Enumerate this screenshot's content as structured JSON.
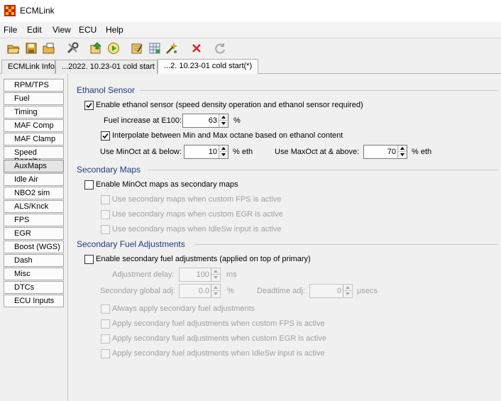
{
  "window": {
    "title": "ECMLink"
  },
  "menu": [
    "File",
    "Edit",
    "View",
    "ECU",
    "Help"
  ],
  "toolbar": [
    "open-folder-icon",
    "save-icon",
    "open-multiple-icon",
    "tools-icon",
    "upload-icon",
    "play-icon",
    "map-edit-icon",
    "grid-edit-icon",
    "wand-icon",
    "close-x-icon",
    "refresh-icon"
  ],
  "tabs": [
    "ECMLink Info",
    "...2022. 10.23-01  cold start",
    "...2. 10.23-01  cold start(*)"
  ],
  "sidebar": [
    "RPM/TPS",
    "Fuel",
    "Timing",
    "MAF Comp",
    "MAF Clamp",
    "Speed Density",
    "AuxMaps",
    "Idle Air",
    "NBO2 sim",
    "ALS/Knck",
    "FPS",
    "EGR",
    "Boost (WGS)",
    "Dash",
    "Misc",
    "DTCs",
    "ECU Inputs"
  ],
  "ethanol": {
    "title": "Ethanol Sensor",
    "enable_label": "Enable ethanol sensor (speed density operation and ethanol sensor required)",
    "enable_checked": true,
    "fuel_increase_label": "Fuel increase at E100:",
    "fuel_increase_value": "63",
    "fuel_increase_unit": "%",
    "interpolate_label": "Interpolate between Min and Max octane based on ethanol content",
    "interpolate_checked": true,
    "minoct_label": "Use MinOct at & below:",
    "minoct_value": "10",
    "minoct_unit": "% eth",
    "maxoct_label": "Use MaxOct at & above:",
    "maxoct_value": "70",
    "maxoct_unit": "% eth"
  },
  "secondary_maps": {
    "title": "Secondary Maps",
    "enable_label": "Enable MinOct maps as secondary maps",
    "fps_label": "Use secondary maps when custom FPS is active",
    "egr_label": "Use secondary maps when custom EGR is active",
    "idlesw_label": "Use secondary maps when IdleSw input is active"
  },
  "secondary_fuel": {
    "title": "Secondary Fuel Adjustments",
    "enable_label": "Enable secondary fuel adjustments (applied on top of primary)",
    "delay_label": "Adjustment delay:",
    "delay_value": "100",
    "delay_unit": "ms",
    "global_label": "Secondary global adj:",
    "global_value": "0.0",
    "global_unit": "%",
    "deadtime_label": "Deadtime adj:",
    "deadtime_value": "0",
    "deadtime_unit": "μsecs",
    "always_label": "Always apply secondary fuel adjustments",
    "fps_label": "Apply secondary fuel adjustments when custom FPS is active",
    "egr_label": "Apply secondary fuel adjustments when custom EGR is active",
    "idlesw_label": "Apply secondary fuel adjustments when IdleSw input is active"
  },
  "colors": {
    "section_title": "#1f3a7a",
    "app_icon_red": "#d21a1a",
    "app_icon_yellow": "#f5c400"
  }
}
